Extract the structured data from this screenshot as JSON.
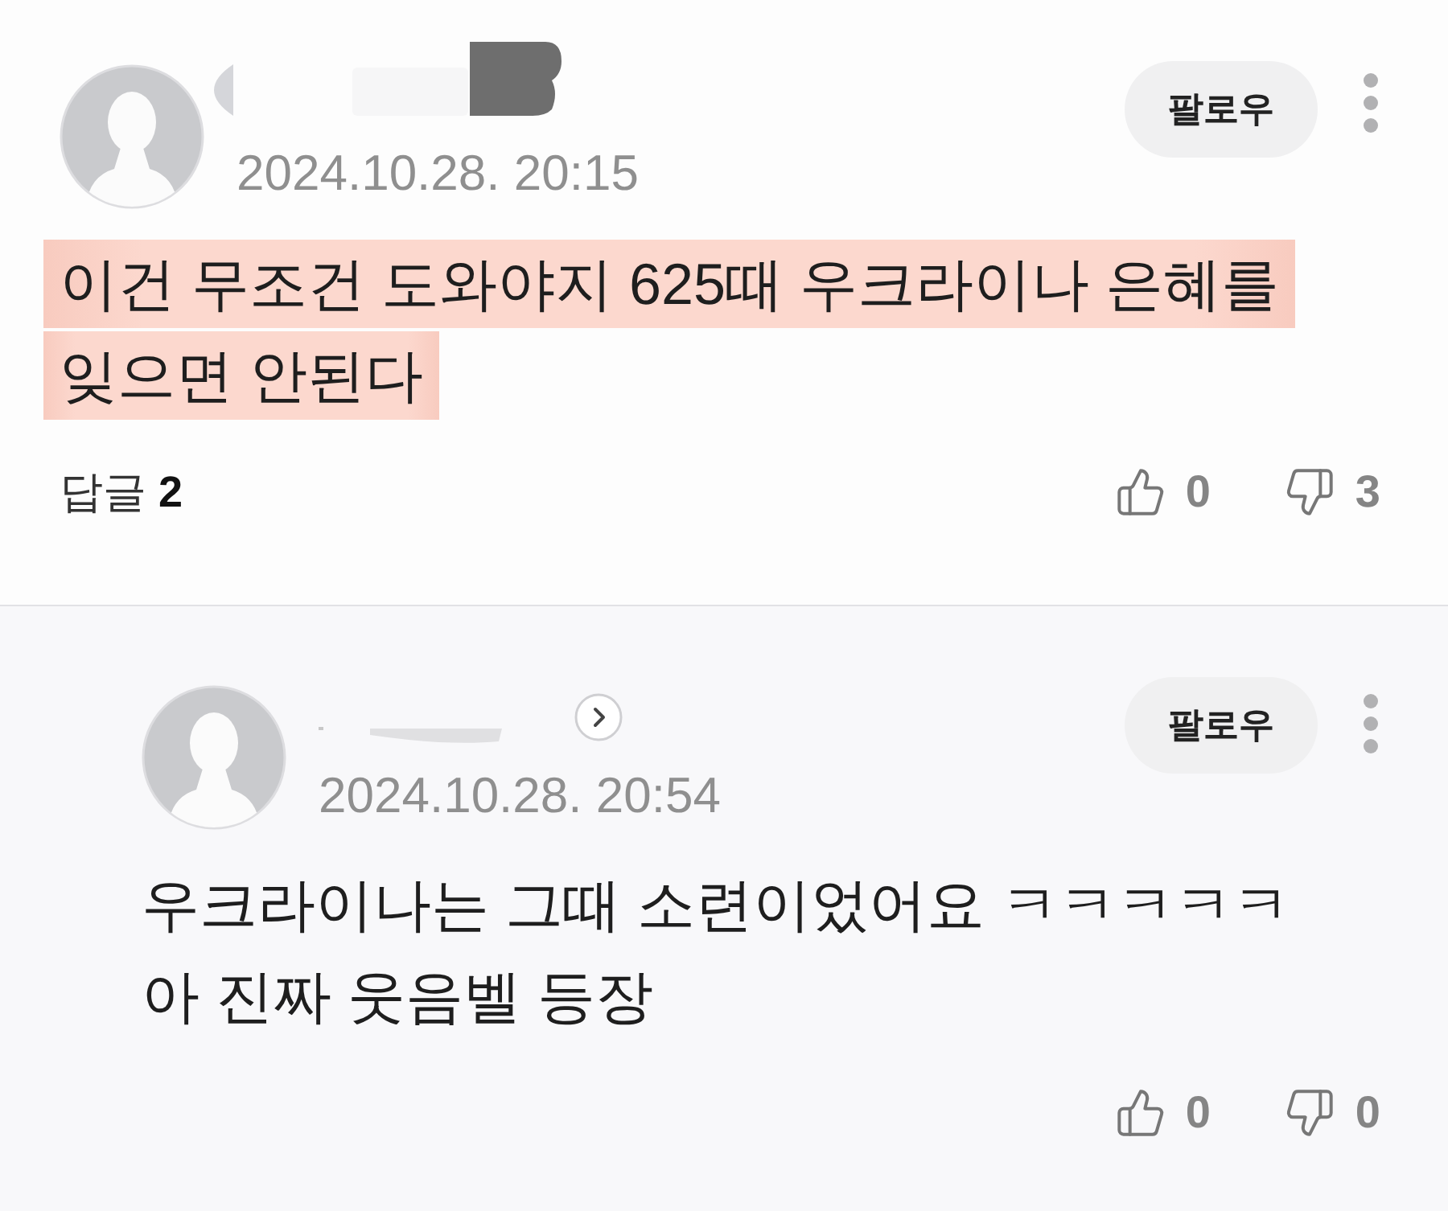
{
  "thread": [
    {
      "kind": "comment",
      "timestamp": "2024.10.28. 20:15",
      "follow_label": "팔로우",
      "text": "이건 무조건 도와야지 625때 우크라이나 은혜를\n잊으면 안된다",
      "highlighted": true,
      "replies_label": "답글 **2**",
      "likes": "0",
      "dislikes": "3"
    },
    {
      "kind": "reply",
      "timestamp": "2024.10.28. 20:54",
      "follow_label": "팔로우",
      "text": "우크라이나는 그때 소련이었어요 ㅋㅋㅋㅋㅋ\n아 진짜 웃음벨 등장",
      "highlighted": false,
      "likes": "0",
      "dislikes": "0"
    }
  ]
}
